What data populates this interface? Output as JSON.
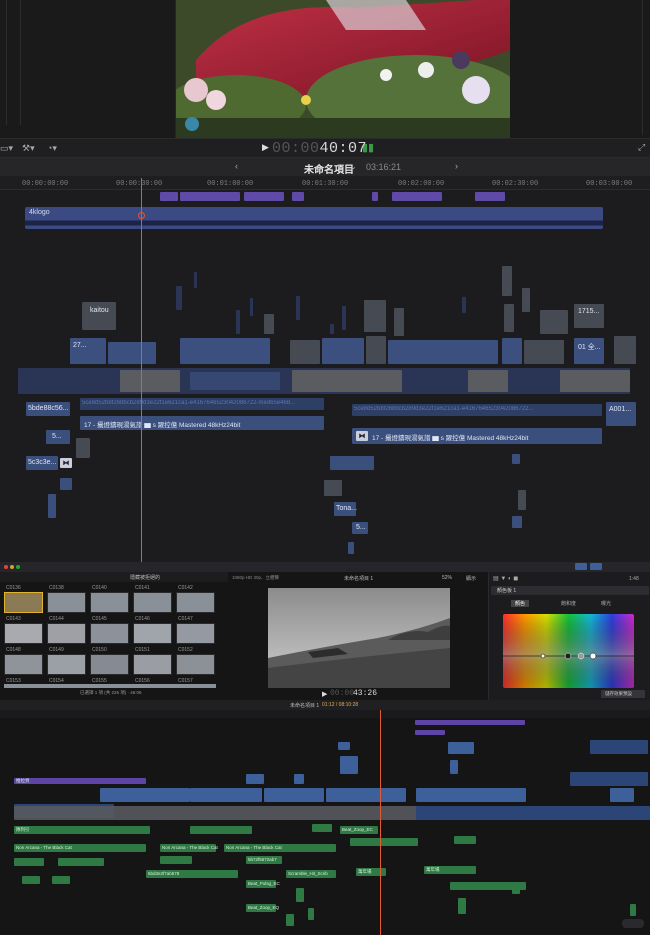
{
  "top": {
    "timecode_dim": "00:00",
    "timecode": "40:07",
    "project_title": "未命名項目",
    "project_duration": "03:16:21",
    "nav_prev": "‹",
    "nav_next": "›",
    "ruler": [
      "00:00:00:00",
      "00:00:30:00",
      "00:01:00:00",
      "00:01:30:00",
      "00:02:00:00",
      "00:02:30:00",
      "00:03:00:00"
    ],
    "title_clip": "4klogo",
    "clip_labels": {
      "kaitou": "kaitou",
      "c27": "27...",
      "c1715": "1715...",
      "c01": "01 全...",
      "sbde": "5bde88c56...",
      "a001": "A001...",
      "c5": "5...",
      "sc3c": "5c3c3e...",
      "tona": "Tona...",
      "c5b": "5...",
      "music1": "17 - 攝燈鑄現湯氣譜 ▆ s 躍控億 Mastered 48kHz24bit",
      "music2": "17 - 攝燈鑄現湯氣譜 ▆ s 躍控億 Mastered 48kHz24bit",
      "hash1": "5ce8d52b8f268bcb289d3e22f1e621ca1-e4167646523042086722-med65e468...",
      "hash2": "5ce8d52b8f268bcb289d3e22f1e621ca1-e4167646523042086722..."
    }
  },
  "bottom": {
    "browser_title": "隱藏被拒絕的",
    "clip_ids": [
      "C0136",
      "C0138",
      "C0140",
      "C0141",
      "C0142",
      "C0143",
      "C0144",
      "C0145",
      "C0146",
      "C0147",
      "C0148",
      "C0149",
      "C0150",
      "C0151",
      "C0152",
      "C0153",
      "C0154",
      "C0155",
      "C0156",
      "C0157"
    ],
    "browser_status": "已選擇 1 項 (共 226 項) · 46:06",
    "viewer_format": "1080p HD 30p、立體聲",
    "viewer_project": "未命名項目 1",
    "zoom": "52%",
    "display": "顯示",
    "timecode": "43:26",
    "timecode_dim": "00:00",
    "inspector_title": "顏色板 1",
    "inspector_time": "1:48",
    "inspector_tabs": [
      "顏色",
      "飽和度",
      "曝光"
    ],
    "inspector_button": "儲存效果預設",
    "tl_project": "未命名項目 1",
    "tl_time": "01:12 / 08:10:28",
    "clip_texts": {
      "a": "隊列引",
      "b": "Non Arcana - The Black Cat",
      "c": "Non Arcana - The Black Cat",
      "d": "Non Arcana - The Black Cat",
      "e": "5bd3e2f7ab578",
      "f": "Beat_Zoop_EC",
      "g": "Beat_Pulsg_EC",
      "h": "Scramble_Hit_Scrib",
      "i": "Beat_Zoop_EQ",
      "j": "萬年場",
      "k": "萬年場",
      "l": "5b72f5572ab7",
      "m": "Beat_Zoop_EQ",
      "n": "推拉頁"
    }
  },
  "colors": {
    "playhead": "#e05a35",
    "clip_blue": "#3c507f",
    "clip_green": "#2f7a44",
    "marker_purple": "#5f4aa8"
  }
}
